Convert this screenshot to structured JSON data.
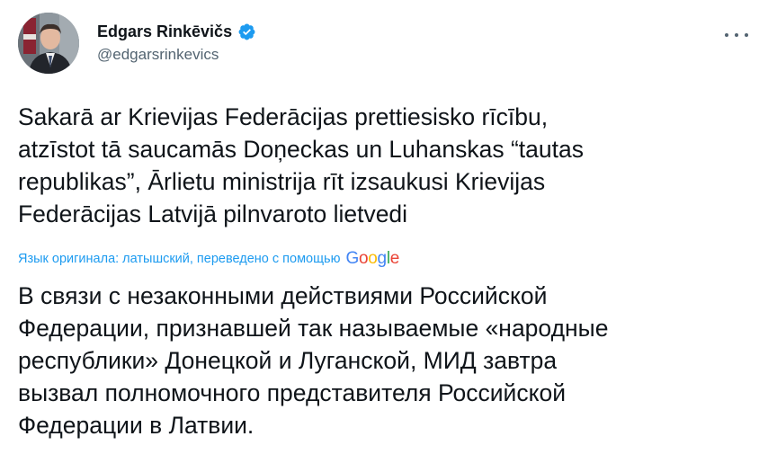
{
  "author": {
    "display_name": "Edgars Rinkēvičs",
    "handle": "@edgarsrinkevics",
    "verified": true
  },
  "more_menu_icon": "more-horizontal-icon",
  "tweet": {
    "original_text": "Sakarā ar Krievijas Federācijas prettiesisko rīcību,\natzīstot tā saucamās Doņeckas un Luhanskas “tautas\nrepublikas”, Ārlietu ministrija rīt izsaukusi Krievijas\nFederācijas Latvijā pilnvaroto lietvedi",
    "translation_note": "Язык оригинала: латышский, переведено с помощью",
    "translation_provider": "Google",
    "translated_text": "В связи с незаконными действиями Российской\nФедерации, признавшей так называемые «народные\nреспублики» Донецкой и Луганской, МИД завтра\nвызвал полномочного представителя Российской\nФедерации в Латвии."
  },
  "colors": {
    "link_blue": "#1d9bf0",
    "verified_blue": "#1d9bf0",
    "text_primary": "#0f1419",
    "text_secondary": "#536471"
  }
}
